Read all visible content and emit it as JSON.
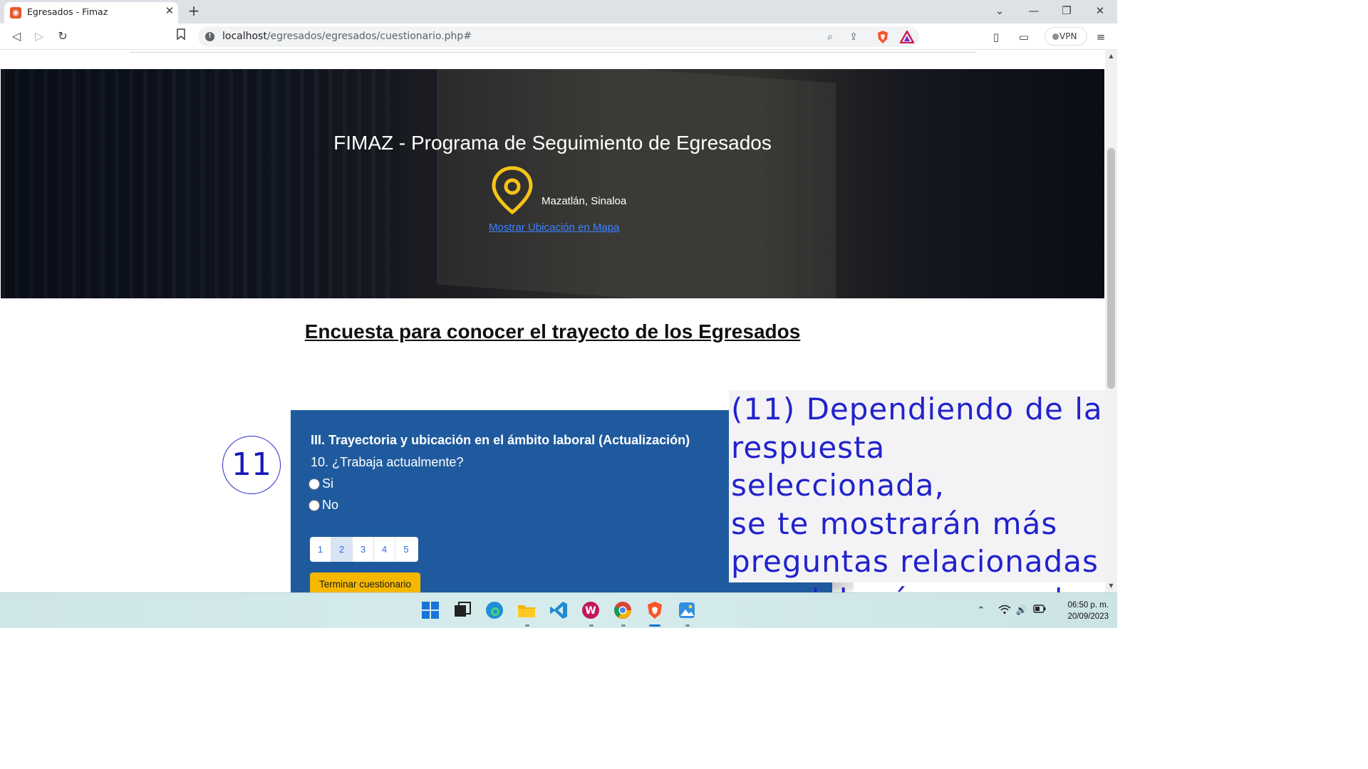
{
  "browser": {
    "tab_title": "Egresados - Fimaz",
    "url_host": "localhost",
    "url_path": "/egresados/egresados/cuestionario.php#",
    "vpn_label": "VPN"
  },
  "hero": {
    "title": "FIMAZ - Programa de Seguimiento de Egresados",
    "location": "Mazatlán, Sinaloa",
    "map_link": "Mostrar Ubicación en Mapa"
  },
  "survey": {
    "heading": "Encuesta para conocer el trayecto de los Egresados",
    "section_title": "III. Trayectoria y ubicación en el ámbito laboral (Actualización)",
    "question": "10. ¿Trabaja actualmente?",
    "options": [
      "Si",
      "No"
    ],
    "pages": [
      "1",
      "2",
      "3",
      "4",
      "5"
    ],
    "active_page": "2",
    "finish_button": "Terminar cuestionario"
  },
  "annotation": {
    "step_number": "11",
    "lines": [
      "(11) Dependiendo de la",
      "respuesta seleccionada,",
      "se te mostrarán más",
      "preguntas relacionadas",
      "que deberás responder."
    ]
  },
  "taskbar": {
    "apps": [
      "start-icon",
      "task-view-icon",
      "edge-icon",
      "file-explorer-icon",
      "vscode-icon",
      "writing-app-icon",
      "chrome-icon",
      "brave-icon",
      "photos-icon"
    ],
    "time": "06:50 p. m.",
    "date": "20/09/2023"
  },
  "colors": {
    "hero_accent": "#f5c518",
    "card_bg": "#1f5a9e",
    "finish_button": "#f5b800",
    "annotation_text": "#2222cc",
    "link": "#3d82ff"
  }
}
